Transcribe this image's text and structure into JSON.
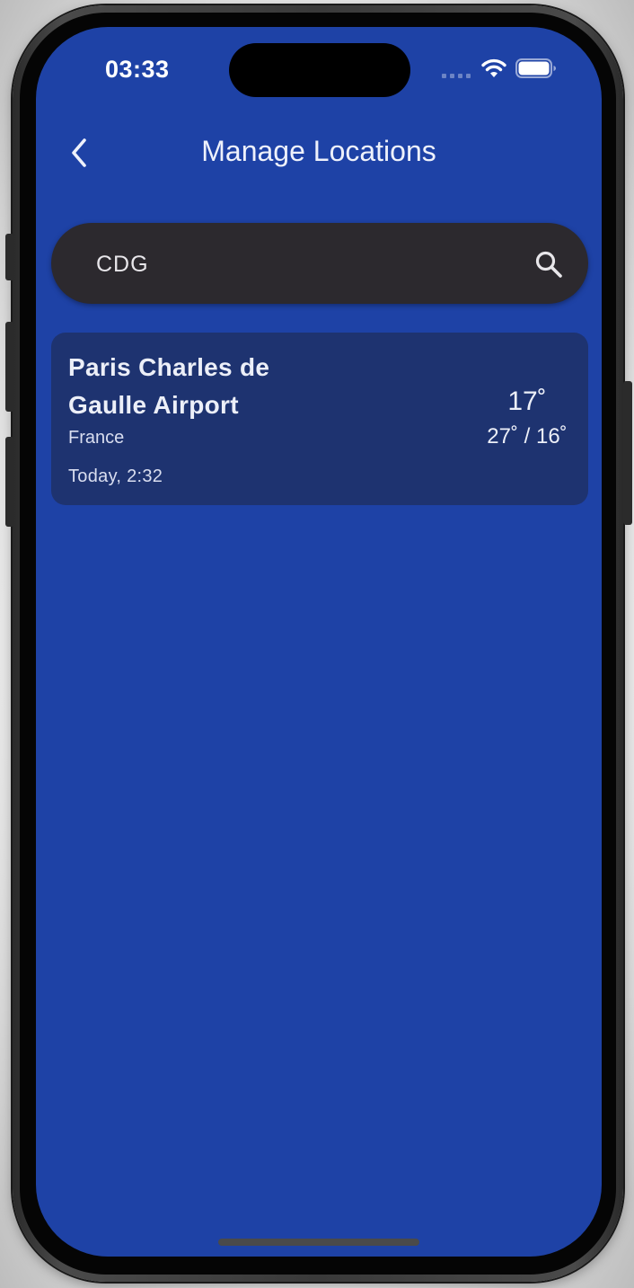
{
  "status_bar": {
    "time": "03:33"
  },
  "header": {
    "title": "Manage Locations",
    "back_icon": "chevron-left-icon"
  },
  "search": {
    "value": "CDG",
    "icon": "search-icon"
  },
  "results": [
    {
      "name": "Paris Charles de Gaulle Airport",
      "country": "France",
      "local_time": "Today, 2:32",
      "weather_icon": "moon-icon",
      "current_temp": "17˚",
      "temp_range": "27˚ / 16˚"
    }
  ],
  "colors": {
    "background": "#1e42a6",
    "search_bar": "#2c292e",
    "card": "#1e3370",
    "moon": "#3b7be0"
  }
}
